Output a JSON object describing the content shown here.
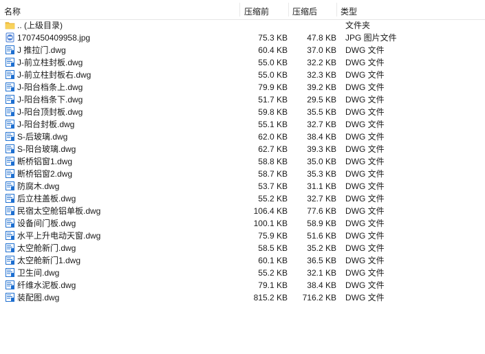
{
  "header": {
    "name": "名称",
    "original_size": "压缩前",
    "compressed_size": "压缩后",
    "type": "类型"
  },
  "files": [
    {
      "name": ".. (上级目录)",
      "original": "",
      "compressed": "",
      "type": "文件夹",
      "icon": "folder-icon"
    },
    {
      "name": "1707450409958.jpg",
      "original": "75.3 KB",
      "compressed": "47.8 KB",
      "type": "JPG 图片文件",
      "icon": "jpg-file-icon"
    },
    {
      "name": "J 推拉门.dwg",
      "original": "60.4 KB",
      "compressed": "37.0 KB",
      "type": "DWG 文件",
      "icon": "dwg-file-icon"
    },
    {
      "name": "J-前立柱封板.dwg",
      "original": "55.0 KB",
      "compressed": "32.2 KB",
      "type": "DWG 文件",
      "icon": "dwg-file-icon"
    },
    {
      "name": "J-前立柱封板右.dwg",
      "original": "55.0 KB",
      "compressed": "32.3 KB",
      "type": "DWG 文件",
      "icon": "dwg-file-icon"
    },
    {
      "name": "J-阳台档条上.dwg",
      "original": "79.9 KB",
      "compressed": "39.2 KB",
      "type": "DWG 文件",
      "icon": "dwg-file-icon"
    },
    {
      "name": "J-阳台档条下.dwg",
      "original": "51.7 KB",
      "compressed": "29.5 KB",
      "type": "DWG 文件",
      "icon": "dwg-file-icon"
    },
    {
      "name": "J-阳台顶封板.dwg",
      "original": "59.8 KB",
      "compressed": "35.5 KB",
      "type": "DWG 文件",
      "icon": "dwg-file-icon"
    },
    {
      "name": "J-阳台封板.dwg",
      "original": "55.1 KB",
      "compressed": "32.7 KB",
      "type": "DWG 文件",
      "icon": "dwg-file-icon"
    },
    {
      "name": "S-后玻璃.dwg",
      "original": "62.0 KB",
      "compressed": "38.4 KB",
      "type": "DWG 文件",
      "icon": "dwg-file-icon"
    },
    {
      "name": "S-阳台玻璃.dwg",
      "original": "62.7 KB",
      "compressed": "39.3 KB",
      "type": "DWG 文件",
      "icon": "dwg-file-icon"
    },
    {
      "name": "断桥铝窗1.dwg",
      "original": "58.8 KB",
      "compressed": "35.0 KB",
      "type": "DWG 文件",
      "icon": "dwg-file-icon"
    },
    {
      "name": "断桥铝窗2.dwg",
      "original": "58.7 KB",
      "compressed": "35.3 KB",
      "type": "DWG 文件",
      "icon": "dwg-file-icon"
    },
    {
      "name": "防腐木.dwg",
      "original": "53.7 KB",
      "compressed": "31.1 KB",
      "type": "DWG 文件",
      "icon": "dwg-file-icon"
    },
    {
      "name": "后立柱盖板.dwg",
      "original": "55.2 KB",
      "compressed": "32.7 KB",
      "type": "DWG 文件",
      "icon": "dwg-file-icon"
    },
    {
      "name": "民宿太空舱铝单板.dwg",
      "original": "106.4 KB",
      "compressed": "77.6 KB",
      "type": "DWG 文件",
      "icon": "dwg-file-icon"
    },
    {
      "name": "设备间门板.dwg",
      "original": "100.1 KB",
      "compressed": "58.9 KB",
      "type": "DWG 文件",
      "icon": "dwg-file-icon"
    },
    {
      "name": "水平上升电动天窗.dwg",
      "original": "75.9 KB",
      "compressed": "51.6 KB",
      "type": "DWG 文件",
      "icon": "dwg-file-icon"
    },
    {
      "name": "太空舱新门.dwg",
      "original": "58.5 KB",
      "compressed": "35.2 KB",
      "type": "DWG 文件",
      "icon": "dwg-file-icon"
    },
    {
      "name": "太空舱新门1.dwg",
      "original": "60.1 KB",
      "compressed": "36.5 KB",
      "type": "DWG 文件",
      "icon": "dwg-file-icon"
    },
    {
      "name": "卫生间.dwg",
      "original": "55.2 KB",
      "compressed": "32.1 KB",
      "type": "DWG 文件",
      "icon": "dwg-file-icon"
    },
    {
      "name": "纤维水泥板.dwg",
      "original": "79.1 KB",
      "compressed": "38.4 KB",
      "type": "DWG 文件",
      "icon": "dwg-file-icon"
    },
    {
      "name": "装配图.dwg",
      "original": "815.2 KB",
      "compressed": "716.2 KB",
      "type": "DWG 文件",
      "icon": "dwg-file-icon"
    }
  ],
  "colors": {
    "folder": "#f5c343",
    "dwg": "#1e6fd0",
    "jpg": "#4a7fd6"
  }
}
